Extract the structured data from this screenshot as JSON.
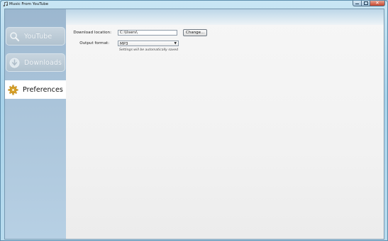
{
  "window": {
    "title": "Music From YouTube",
    "minimize_glyph": "—",
    "close_glyph": "✕"
  },
  "sidebar": {
    "items": [
      {
        "label": "YouTube",
        "icon": "search-icon",
        "state": "inactive"
      },
      {
        "label": "Downloads",
        "icon": "download-icon",
        "state": "inactive"
      },
      {
        "label": "Preferences",
        "icon": "gear-icon",
        "state": "active"
      }
    ]
  },
  "preferences": {
    "download_location": {
      "label": "Download location:",
      "value": "C:\\Users\\",
      "change_button": "Change..."
    },
    "output_format": {
      "label": "Output format:",
      "selected": "MP3"
    },
    "note": "Settings will be automatically saved"
  },
  "colors": {
    "accent_frame": "#5f8fae",
    "sidebar": "#a9c3d9",
    "content_bg": "#f2f2f2"
  }
}
